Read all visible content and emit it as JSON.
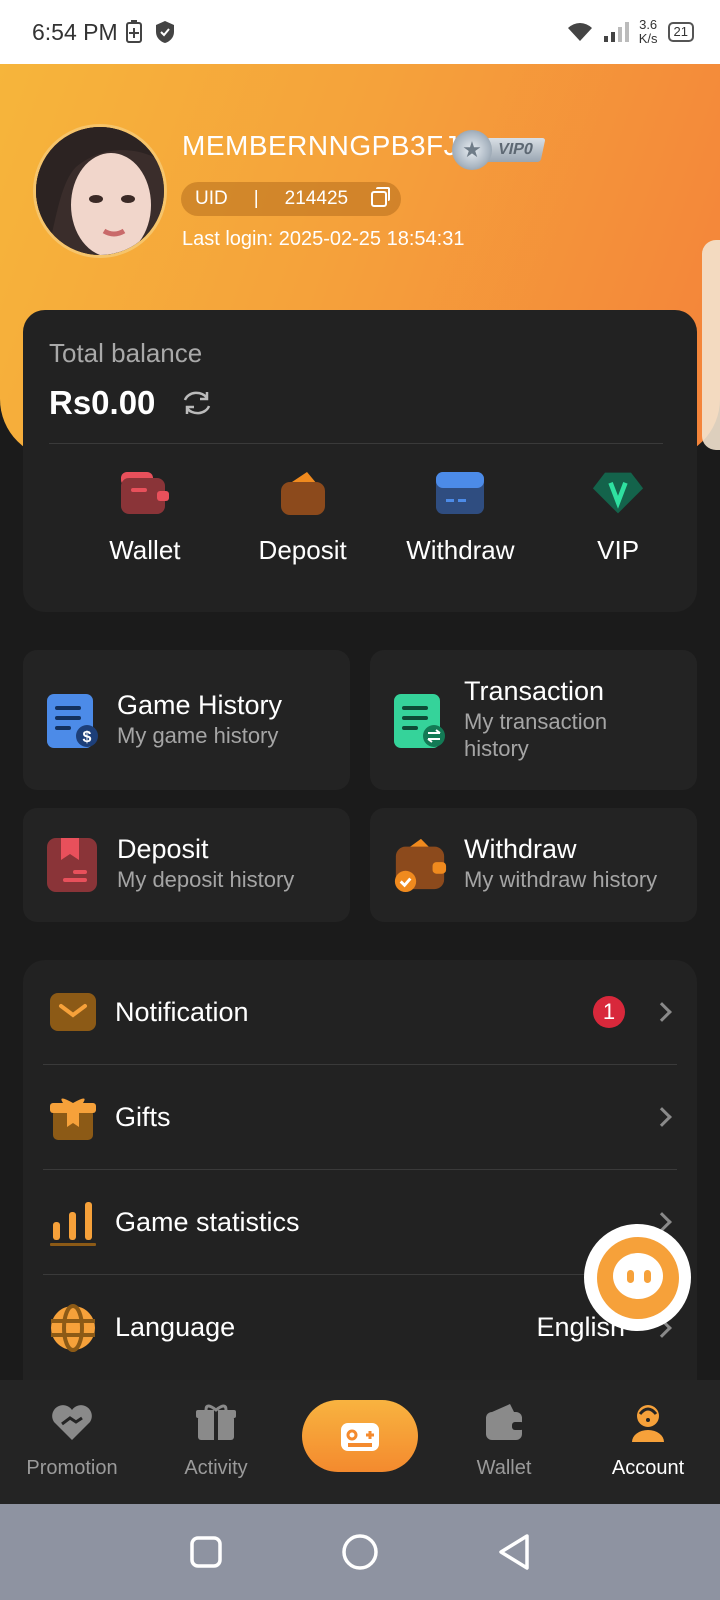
{
  "status_bar": {
    "time": "6:54 PM",
    "net_speed_value": "3.6",
    "net_speed_unit": "K/s",
    "battery": "21"
  },
  "profile": {
    "username": "MEMBERNNGPB3FJ",
    "vip_level": "VIP0",
    "uid_label": "UID",
    "uid_separator": "|",
    "uid": "214425",
    "last_login": "Last login: 2025-02-25 18:54:31"
  },
  "balance": {
    "title": "Total balance",
    "amount": "Rs0.00",
    "actions": [
      {
        "label": "Wallet",
        "icon": "wallet-icon"
      },
      {
        "label": "Deposit",
        "icon": "deposit-icon"
      },
      {
        "label": "Withdraw",
        "icon": "withdraw-card-icon"
      },
      {
        "label": "VIP",
        "icon": "vip-gem-icon"
      }
    ]
  },
  "history": [
    {
      "title": "Game History",
      "subtitle": "My game history",
      "icon": "game-history-icon"
    },
    {
      "title": "Transaction",
      "subtitle": "My transaction history",
      "icon": "transaction-icon"
    },
    {
      "title": "Deposit",
      "subtitle": "My deposit history",
      "icon": "deposit-history-icon"
    },
    {
      "title": "Withdraw",
      "subtitle": "My withdraw history",
      "icon": "withdraw-history-icon"
    }
  ],
  "menu": [
    {
      "label": "Notification",
      "badge": "1",
      "icon": "mail-icon"
    },
    {
      "label": "Gifts",
      "icon": "gift-icon"
    },
    {
      "label": "Game statistics",
      "icon": "bar-chart-icon"
    },
    {
      "label": "Language",
      "value": "English",
      "icon": "globe-icon"
    }
  ],
  "tabbar": [
    {
      "label": "Promotion",
      "icon": "promotion-icon"
    },
    {
      "label": "Activity",
      "icon": "activity-gift-icon"
    },
    {
      "label": "",
      "icon": "gamepad-icon"
    },
    {
      "label": "Wallet",
      "icon": "wallet-tab-icon"
    },
    {
      "label": "Account",
      "icon": "account-icon",
      "active": true
    }
  ],
  "colors": {
    "accent": "#f6a13a",
    "card": "#222222",
    "background": "#1b1b1b",
    "badge": "#d8283b"
  }
}
